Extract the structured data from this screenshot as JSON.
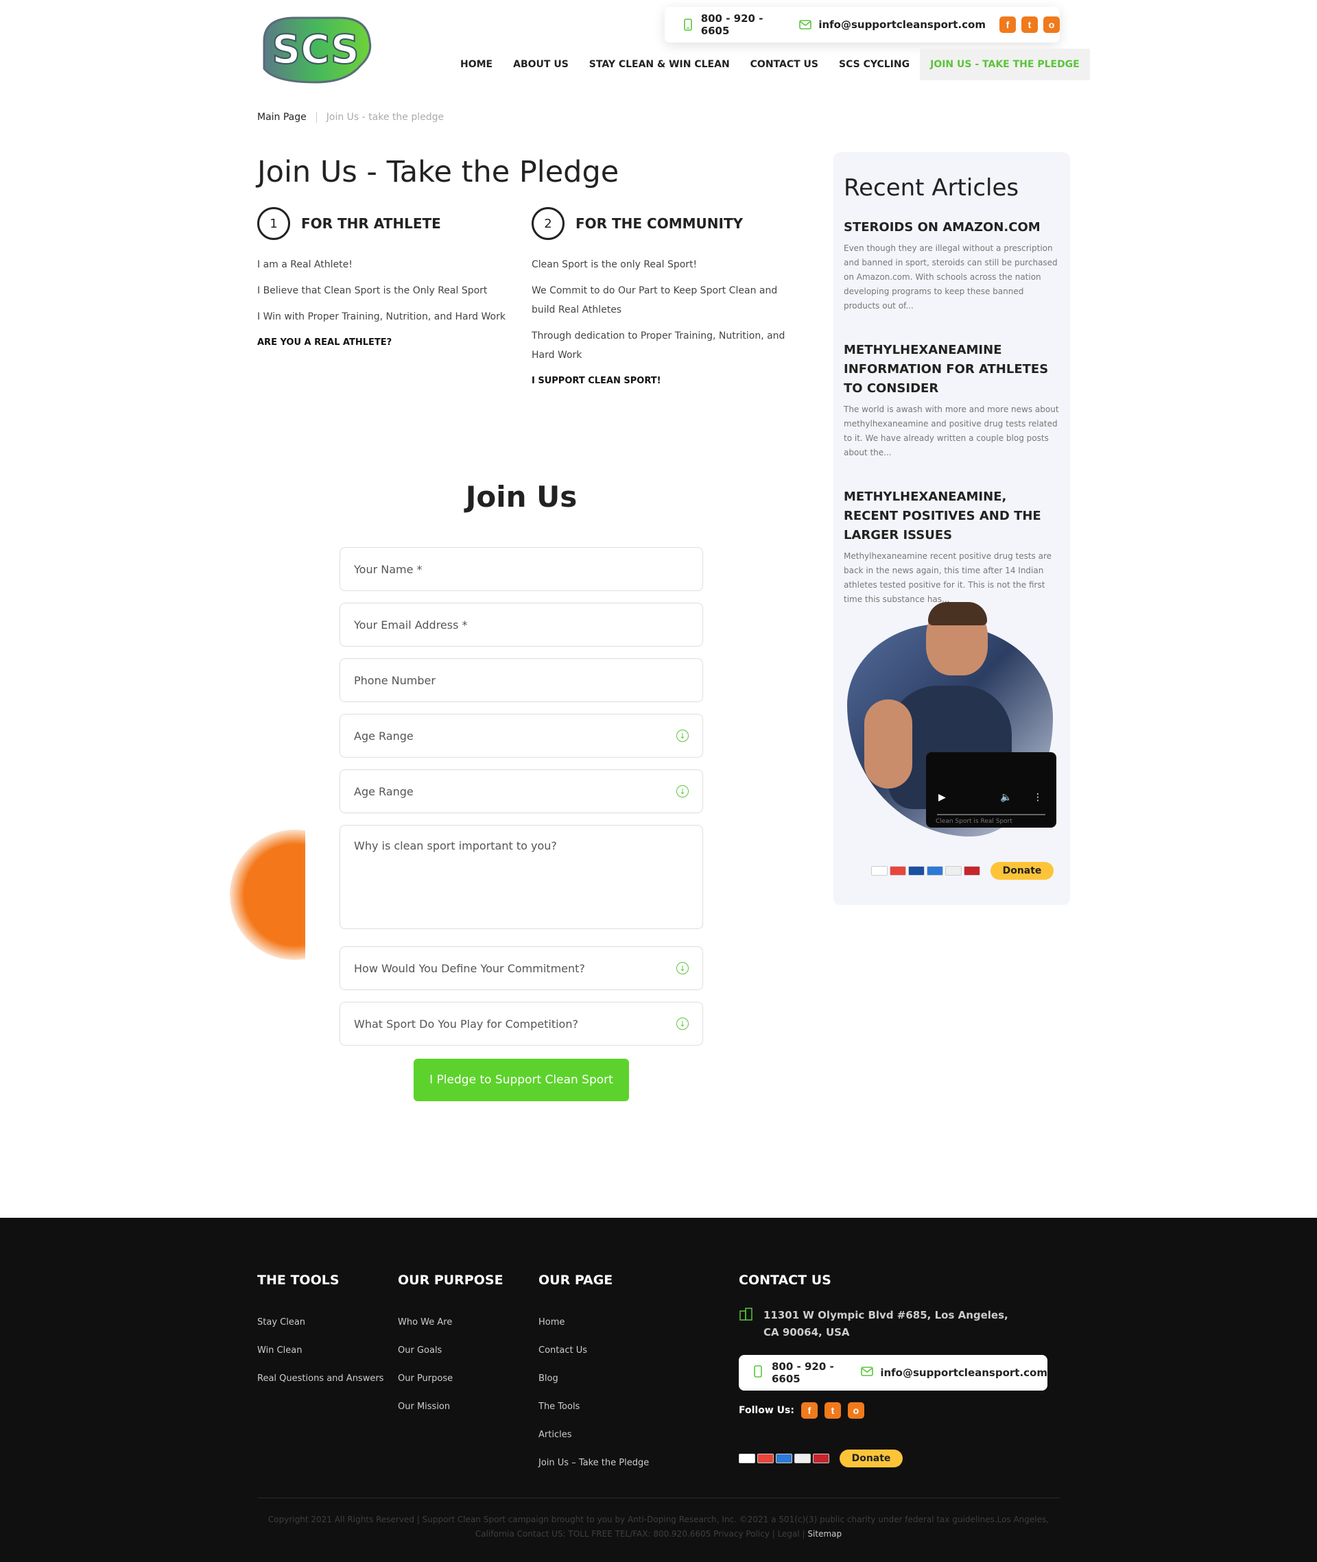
{
  "header": {
    "logo_text": "SCS",
    "phone": "800 - 920 - 6605",
    "email": "info@supportcleansport.com",
    "social": [
      "f",
      "t",
      "o"
    ],
    "nav": [
      "HOME",
      "ABOUT US",
      "STAY CLEAN & WIN CLEAN",
      "CONTACT US",
      "SCS CYCLING",
      "JOIN US - TAKE THE PLEDGE"
    ]
  },
  "breadcrumb": {
    "home": "Main Page",
    "current": "Join Us - take the pledge"
  },
  "page_title": "Join Us - Take the Pledge",
  "athlete": {
    "num": "1",
    "title": "FOR THR ATHLETE",
    "lines": [
      "I am a Real Athlete!",
      "I Believe that Clean Sport is the Only Real Sport",
      "I Win with Proper Training, Nutrition, and Hard Work"
    ],
    "cta": "ARE YOU A REAL ATHLETE?"
  },
  "community": {
    "num": "2",
    "title": "FOR THE COMMUNITY",
    "lines": [
      "Clean Sport is the only Real Sport!",
      "We Commit to do Our Part to Keep Sport Clean and build Real Athletes",
      "Through dedication to Proper Training, Nutrition, and Hard Work"
    ],
    "cta": "I SUPPORT CLEAN SPORT!"
  },
  "form": {
    "title": "Join Us",
    "name": "Your Name *",
    "email": "Your Email Address *",
    "phone": "Phone Number",
    "age1": "Age Range",
    "age2": "Age Range",
    "why": "Why is clean sport important to you?",
    "commitment": "How Would You Define Your Commitment?",
    "sport": "What Sport Do You Play for Competition?",
    "submit": "I Pledge to Support Clean Sport"
  },
  "sidebar": {
    "title": "Recent Articles",
    "articles": [
      {
        "title": "STEROIDS ON AMAZON.COM",
        "excerpt": "Even though they are illegal without a prescription and banned in sport, steroids can still be purchased on Amazon.com. With schools across the nation developing programs to keep these banned products out of..."
      },
      {
        "title": "METHYLHEXANEAMINE INFORMATION FOR ATHLETES TO CONSIDER",
        "excerpt": "The world is awash with more and more news about methylhexaneamine and positive drug tests related to it. We have already written a couple blog posts about the..."
      },
      {
        "title": "METHYLHEXANEAMINE, RECENT POSITIVES AND THE LARGER ISSUES",
        "excerpt": "Methylhexaneamine recent positive drug tests are back in the news again, this time after 14 Indian athletes tested positive for it. This is not the first time this substance has..."
      }
    ],
    "video_caption": "Clean Sport is Real Sport",
    "donate": "Donate"
  },
  "footer": {
    "tools": {
      "title": "THE TOOLS",
      "links": [
        "Stay Clean",
        "Win Clean",
        "Real Questions and Answers"
      ]
    },
    "purpose": {
      "title": "OUR PURPOSE",
      "links": [
        "Who We Are",
        "Our Goals",
        "Our Purpose",
        "Our Mission"
      ]
    },
    "page": {
      "title": "OUR PAGE",
      "links": [
        "Home",
        "Contact Us",
        "Blog",
        "The Tools",
        "Articles",
        "Join Us – Take the Pledge"
      ]
    },
    "contact": {
      "title": "CONTACT US",
      "address1": "11301 W Olympic Blvd #685, Los Angeles,",
      "address2": "CA 90064, USA",
      "phone": "800 - 920 - 6605",
      "email": "info@supportcleansport.com",
      "follow": "Follow Us:",
      "donate": "Donate"
    },
    "copyright1": "Copyright 2021 All Rights Reserved | Support Clean Sport campaign brought to you by Anti-Doping Research, Inc. ©2021 a 501(c)(3) public charity under federal tax guidelines.Los Angeles,",
    "copyright2": "California Contact US: TOLL FREE TEL/FAX: 800.920.6605 Privacy Policy | Legal |",
    "sitemap": "Sitemap"
  },
  "colors": {
    "accent_green": "#5ac53a",
    "orange": "#f07a1c",
    "footer_bg": "#101010",
    "donate_yellow": "#fdc439"
  }
}
